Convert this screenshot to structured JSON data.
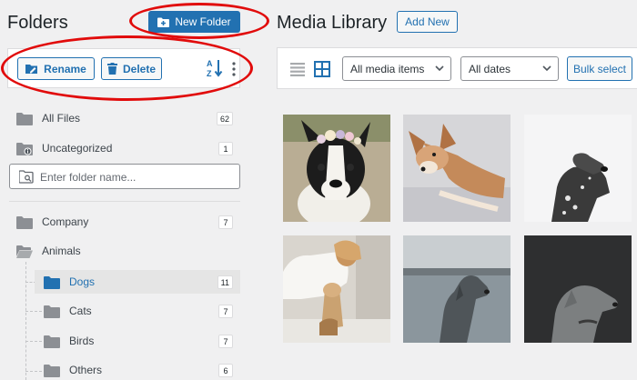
{
  "folders": {
    "title": "Folders",
    "new_folder_label": "New Folder",
    "toolbar": {
      "rename_label": "Rename",
      "delete_label": "Delete"
    },
    "special": [
      {
        "label": "All Files",
        "count": "62"
      },
      {
        "label": "Uncategorized",
        "count": "1"
      }
    ],
    "search_placeholder": "Enter folder name...",
    "tree": [
      {
        "label": "Company",
        "count": "7"
      },
      {
        "label": "Animals",
        "count": ""
      },
      {
        "label": "Dogs",
        "count": "11"
      },
      {
        "label": "Cats",
        "count": "7"
      },
      {
        "label": "Birds",
        "count": "7"
      },
      {
        "label": "Others",
        "count": "6"
      }
    ]
  },
  "media": {
    "title": "Media Library",
    "add_new_label": "Add New",
    "filter_type": "All media items",
    "filter_date": "All dates",
    "bulk_select_label": "Bulk select"
  },
  "colors": {
    "accent": "#2271b1",
    "annotation": "#e10b0b",
    "selected_bg": "#e5e5e5"
  },
  "icons": [
    "folder-plus-icon",
    "rename-icon",
    "trash-icon",
    "sort-icon",
    "more-icon",
    "folder-icon",
    "search-folder-icon",
    "list-view-icon",
    "grid-view-icon",
    "chevron-down-icon"
  ]
}
